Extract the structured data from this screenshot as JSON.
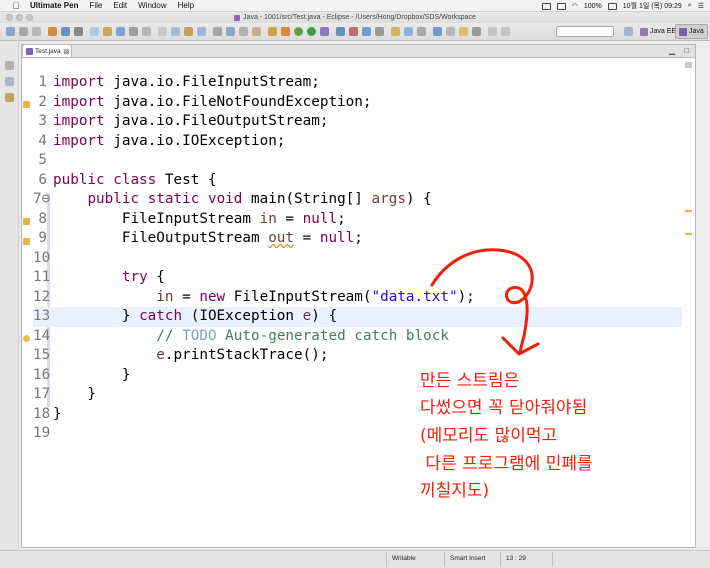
{
  "menubar": {
    "app_name": "Ultimate Pen",
    "items": [
      "File",
      "Edit",
      "Window",
      "Help"
    ],
    "status": {
      "battery": "100%",
      "clock": "10월 1일 (목)  09:29"
    }
  },
  "window": {
    "title": "Java - 1001/src/Test.java - Eclipse - /Users/Hong/Dropbox/SDS/Workspace"
  },
  "perspectives": [
    {
      "label": "Java EE"
    },
    {
      "label": "Java"
    }
  ],
  "editor": {
    "tab_label": "Test.java",
    "tab_close": "⊠"
  },
  "code": {
    "lines": [
      {
        "n": "1",
        "text": "import java.io.FileInputStream;"
      },
      {
        "n": "2",
        "text": "import java.io.FileNotFoundException;"
      },
      {
        "n": "3",
        "text": "import java.io.FileOutputStream;"
      },
      {
        "n": "4",
        "text": "import java.io.IOException;"
      },
      {
        "n": "5",
        "text": ""
      },
      {
        "n": "6",
        "text": "public class Test {"
      },
      {
        "n": "7⊖",
        "text": "    public static void main(String[] args) {"
      },
      {
        "n": "8",
        "text": "        FileInputStream in = null;"
      },
      {
        "n": "9",
        "text": "        FileOutputStream out = null;"
      },
      {
        "n": "10",
        "text": ""
      },
      {
        "n": "11",
        "text": "        try {"
      },
      {
        "n": "12",
        "text": "            in = new FileInputStream(\"data.txt\");"
      },
      {
        "n": "13",
        "text": "        } catch (IOException e) {"
      },
      {
        "n": "14",
        "text": "            // TODO Auto-generated catch block"
      },
      {
        "n": "15",
        "text": "            e.printStackTrace();"
      },
      {
        "n": "16",
        "text": "        }"
      },
      {
        "n": "17",
        "text": "    }"
      },
      {
        "n": "18",
        "text": "}"
      },
      {
        "n": "19",
        "text": ""
      }
    ],
    "current_line": 13
  },
  "statusbar": {
    "mode": "Writable",
    "insert": "Smart Insert",
    "position": "13 : 29"
  },
  "annotation": {
    "lines": [
      "만든 스트림은",
      "다썼으면 꼭 닫아줘야됨",
      "(메모리도 많이먹고",
      " 다른 프로그램에 민폐를",
      "끼칠지도)"
    ],
    "color": "#f0200c"
  }
}
